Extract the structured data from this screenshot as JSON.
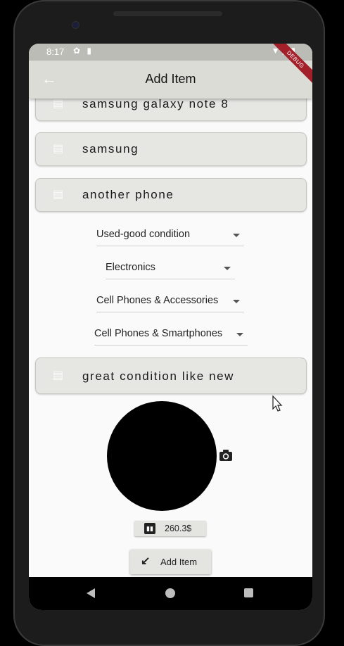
{
  "status_bar": {
    "time": "8:17",
    "left_icons": [
      "settings-icon",
      "sd-card-icon"
    ],
    "right_icons": [
      "wifi-icon",
      "signal-icon",
      "battery-icon"
    ]
  },
  "app_bar": {
    "title": "Add Item",
    "back_icon": "arrow-back-icon",
    "debug_banner": "DEBUG"
  },
  "form": {
    "name_field": {
      "value": "samsung galaxy note 8",
      "icon": "notes-icon"
    },
    "brand_field": {
      "value": "samsung",
      "icon": "notes-icon"
    },
    "model_field": {
      "value": "another phone",
      "icon": "notes-icon"
    },
    "condition_dropdown": {
      "selected": "Used-good condition"
    },
    "category_dropdown": {
      "selected": "Electronics"
    },
    "subcategory_dropdown": {
      "selected": "Cell Phones & Accessories"
    },
    "subsubcategory_dropdown": {
      "selected": "Cell Phones & Smartphones"
    },
    "description_field": {
      "value": "great condition like new",
      "icon": "notes-icon"
    },
    "image": {
      "placeholder_color": "#000000",
      "camera_icon": "camera-icon"
    },
    "price": {
      "value": "260.3$",
      "icon": "price-chart-icon"
    },
    "add_button": {
      "label": "Add Item",
      "icon": "arrow-down-left-icon"
    }
  },
  "nav_bar": {
    "icons": [
      "nav-back-icon",
      "nav-home-icon",
      "nav-recent-icon"
    ]
  },
  "colors": {
    "app_bar": "#dcdcd6",
    "status_bar": "#bcbcb6",
    "card": "#e6e6e2",
    "screen_background": "#fafafa",
    "debug_banner": "#a3202a"
  }
}
